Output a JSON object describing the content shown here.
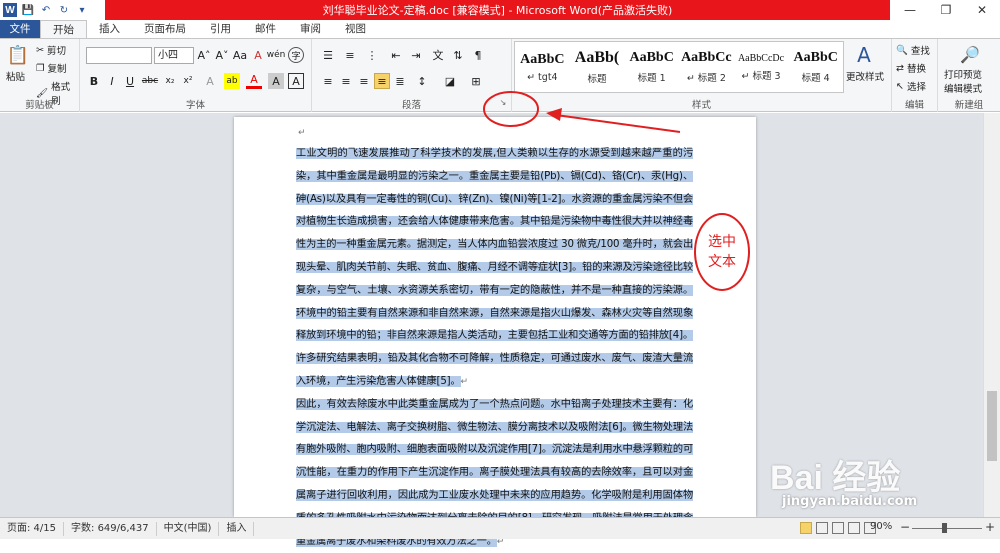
{
  "window": {
    "title": "刘华聪毕业论文-定稿.doc [兼容模式] - Microsoft Word(产品激活失败)",
    "minimize": "—",
    "restore": "❐",
    "close": "✕"
  },
  "quick_access": [
    "W",
    "💾",
    "↶",
    "↻",
    "▾"
  ],
  "tabs": [
    "文件",
    "开始",
    "插入",
    "页面布局",
    "引用",
    "邮件",
    "审阅",
    "视图"
  ],
  "ribbon": {
    "clipboard": {
      "label": "剪贴板",
      "paste": "粘贴",
      "cut": "剪切",
      "copy": "复制",
      "format_painter": "格式刷"
    },
    "font": {
      "label": "字体",
      "font_name": "",
      "font_size": "小四",
      "bold": "B",
      "italic": "I",
      "underline": "U",
      "strike": "abc",
      "sub": "x₂",
      "sup": "x²",
      "grow": "A˄",
      "shrink": "A˅",
      "case": "Aa",
      "clear": "A",
      "highlight": "ab",
      "color": "A",
      "shade": "A",
      "border": "A",
      "phonetic": "wén",
      "encircle": "字"
    },
    "paragraph": {
      "label": "段落"
    },
    "styles": {
      "label": "样式",
      "items": [
        {
          "preview": "AaBbC",
          "name": "↵ tgt4"
        },
        {
          "preview": "AaBb(",
          "name": "标题"
        },
        {
          "preview": "AaBbC",
          "name": "标题 1"
        },
        {
          "preview": "AaBbCc",
          "name": "↵ 标题 2"
        },
        {
          "preview": "AaBbCcDc",
          "name": "↵ 标题 3"
        },
        {
          "preview": "AaBbC",
          "name": "标题 4"
        }
      ],
      "change_styles": "更改样式"
    },
    "editing": {
      "label": "编辑",
      "find": "查找",
      "replace": "替换",
      "select": "选择"
    },
    "new_group": {
      "label": "新建组",
      "print_preview": "打印预览",
      "edit_mode": "编辑模式"
    }
  },
  "document": {
    "line0": "↵",
    "para1": "工业文明的飞速发展推动了科学技术的发展,但人类赖以生存的水源受到越来越严重的污染，其中重金属是最明显的污染之一。重金属主要是铅(Pb)、镉(Cd)、铬(Cr)、汞(Hg)、砷(As)以及具有一定毒性的铜(Cu)、锌(Zn)、镍(Ni)等[1-2]。水资源的重金属污染不但会对植物生长造成损害，还会给人体健康带来危害。其中铅是污染物中毒性很大并以神经毒性为主的一种重金属元素。据测定，当人体内血铅尝浓度过 30 微克/100 毫升时，就会出现头晕、肌肉关节前、失眠、贫血、腹痛、月经不调等症状[3]。铅的来源及污染途径比较复杂，与空气、土壤、水资源关系密切，带有一定的隐蔽性，并不是一种直接的污染源。环境中的铅主要有自然来源和非自然来源，自然来源是指火山爆发、森林火灾等自然现象释放到环境中的铅；非自然来源是指人类活动，主要包括工业和交通等方面的铅排放[4]。许多研究结果表明，铅及其化合物不可降解，性质稳定，可通过废水、废气、废渣大量流入环境，产生污染危害人体健康[5]。",
    "para2": "因此，有效去除废水中此类重金属成为了一个热点问题。水中铅离子处理技术主要有：化学沉淀法、电解法、离子交换树脂、微生物法、膜分离技术以及吸附法[6]。微生物处理法有胞外吸附、胞内吸附、细胞表面吸附以及沉淀作用[7]。沉淀法是利用水中悬浮颗粒的可沉性能，在重力的作用下产生沉淀作用。离子膜处理法具有较高的去除效率，且可以对金属离子进行回收利用，因此成为工业废水处理中未来的应用趋势。化学吸附是利用固体物质的多孔性吸附水中污染物而达到分离去除的目的[8]。研究发现，吸附法是常用于处理含重金属离子废水和染料废水的有效方法之一。",
    "pilcrow": "↵"
  },
  "annotation": {
    "line1": "选中",
    "line2": "文本"
  },
  "watermark": {
    "brand": "Bai 经验",
    "url": "jingyan.baidu.com"
  },
  "status": {
    "page": "页面: 4/15",
    "words": "字数: 649/6,437",
    "lang": "中文(中国)",
    "mode": "插入",
    "zoom": "90%",
    "minus": "−",
    "plus": "+"
  },
  "colors": {
    "accent": "#2b579a",
    "title_red": "#e8151b",
    "selection": "#b3cbe9",
    "annotation": "#e02020"
  }
}
